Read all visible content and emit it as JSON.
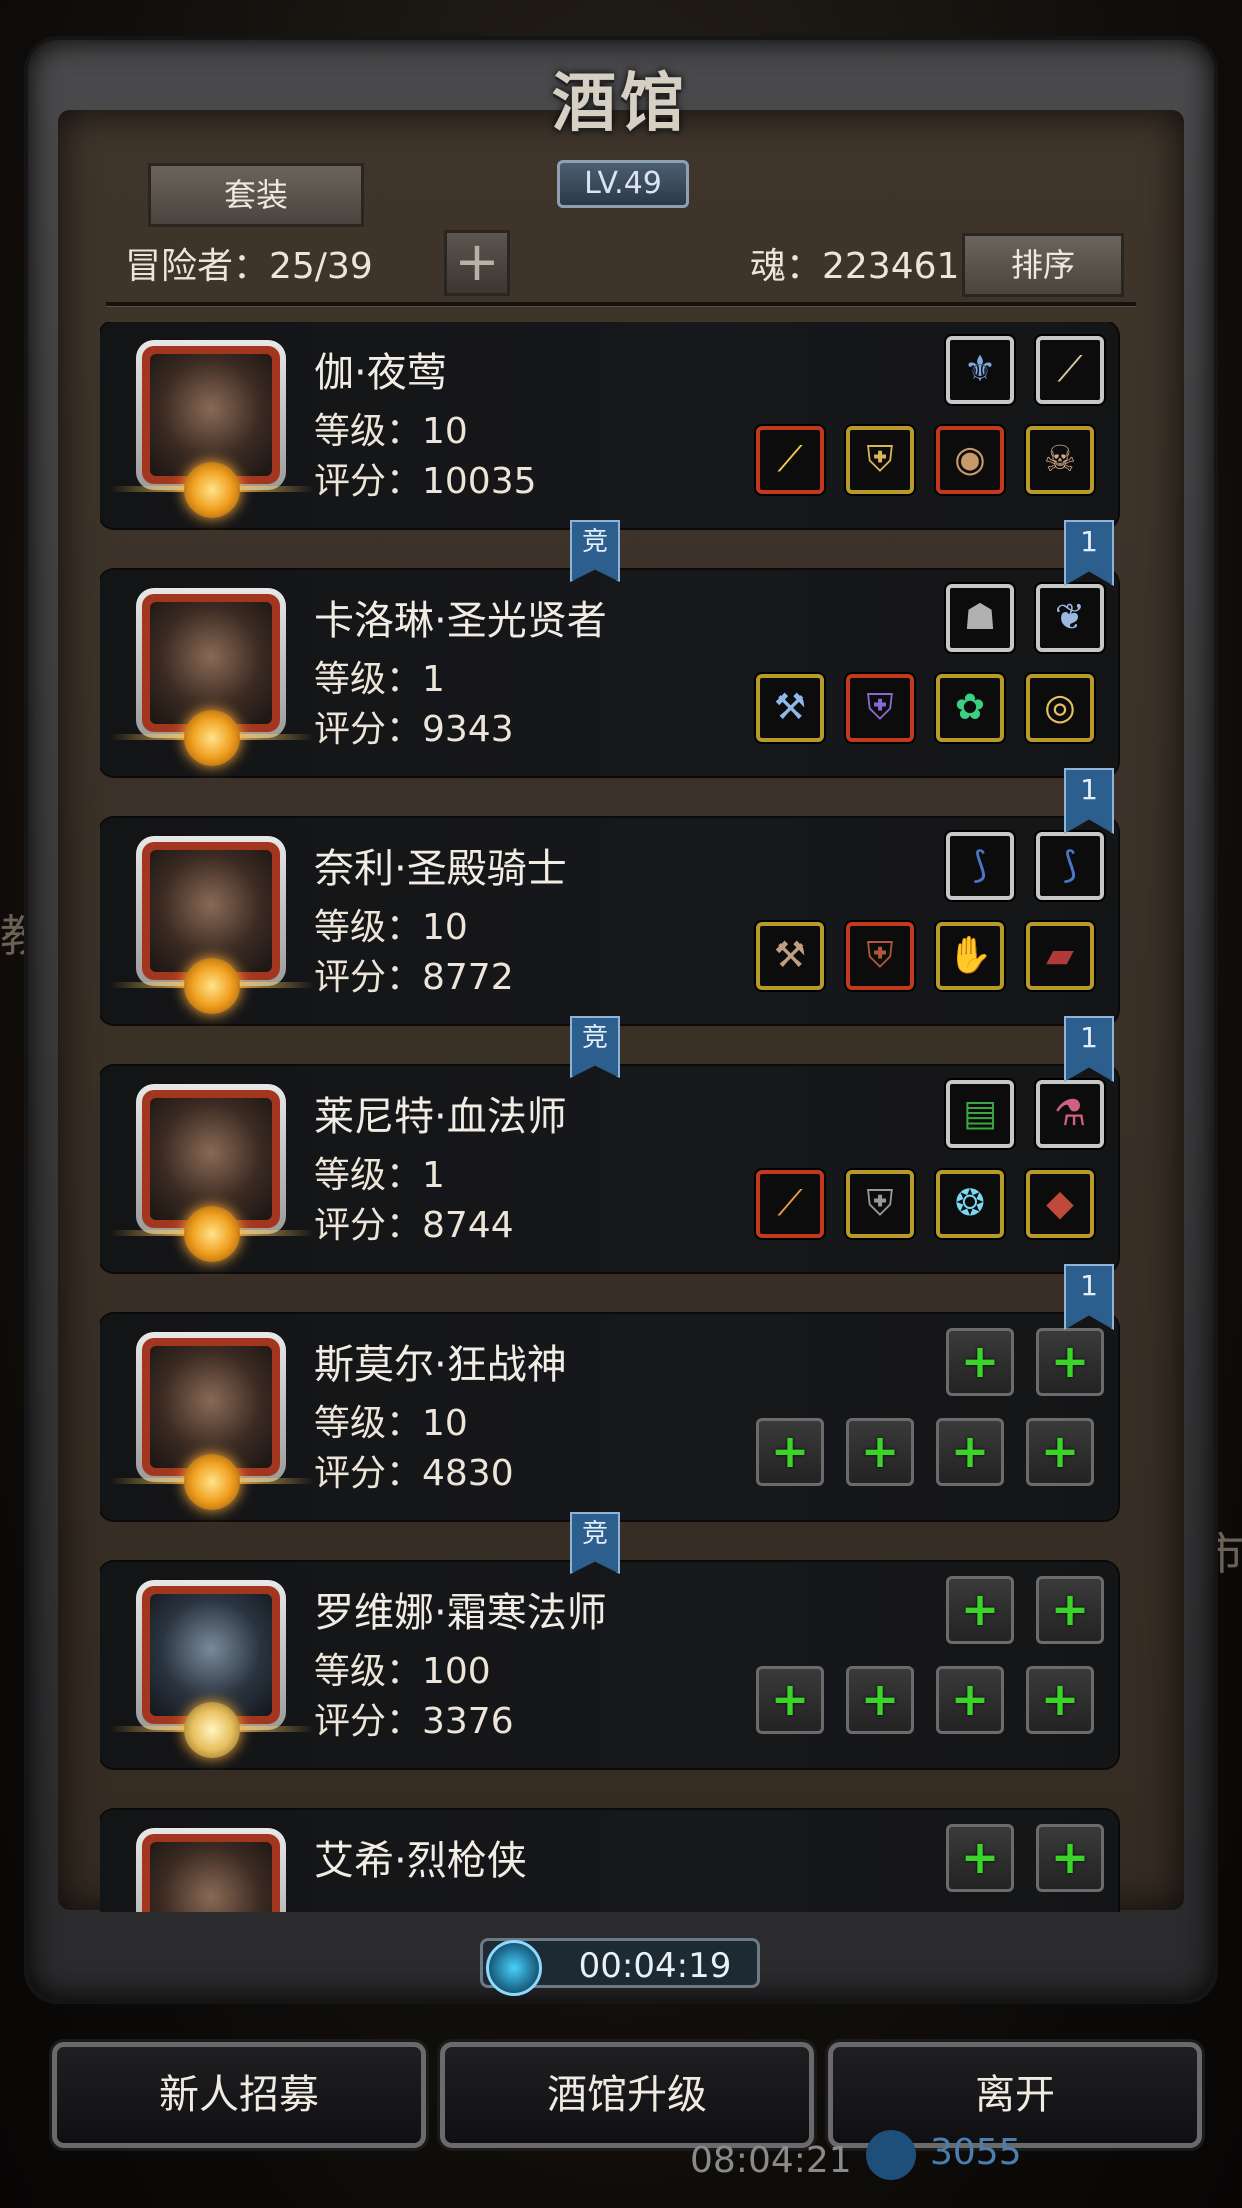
{
  "header": {
    "title": "酒馆",
    "level": "LV.49"
  },
  "toolbar": {
    "set_label": "套装",
    "adventurer_label": "冒险者：25/39",
    "plus": "+",
    "soul_label": "魂：223461",
    "sort_label": "排序"
  },
  "side": {
    "left_char": "教",
    "right_char": "市"
  },
  "heroes": [
    {
      "name": "伽·夜莺",
      "level": "等级：10",
      "score": "评分：10035",
      "slots": [
        "⚜",
        "⟋",
        "⟋",
        "⛨",
        "◉",
        "☠"
      ]
    },
    {
      "name": "卡洛琳·圣光贤者",
      "level": "等级：1",
      "score": "评分：9343",
      "slots": [
        "☗",
        "❦",
        "⚒",
        "⛨",
        "✿",
        "◎"
      ]
    },
    {
      "name": "奈利·圣殿骑士",
      "level": "等级：10",
      "score": "评分：8772",
      "slots": [
        "⟆",
        "⟆",
        "⚒",
        "⛨",
        "✋",
        "▰"
      ]
    },
    {
      "name": "莱尼特·血法师",
      "level": "等级：1",
      "score": "评分：8744",
      "slots": [
        "▤",
        "⚗",
        "⟋",
        "⛨",
        "❂",
        "◆"
      ]
    },
    {
      "name": "斯莫尔·狂战神",
      "level": "等级：10",
      "score": "评分：4830",
      "slots": [
        "+",
        "+",
        "+",
        "+",
        "+",
        "+"
      ]
    },
    {
      "name": "罗维娜·霜寒法师",
      "level": "等级：100",
      "score": "评分：3376",
      "slots": [
        "+",
        "+",
        "+",
        "+",
        "+",
        "+"
      ]
    },
    {
      "name": "艾希·烈枪侠",
      "level": "",
      "score": "",
      "slots": [
        "+",
        "+",
        "",
        "",
        "",
        ""
      ]
    }
  ],
  "tags": {
    "comp": "竞",
    "one": "1"
  },
  "timer": "00:04:19",
  "buttons": {
    "recruit": "新人招募",
    "upgrade": "酒馆升级",
    "leave": "离开"
  },
  "status": {
    "clock": "08:04:21",
    "gems": "3055"
  }
}
